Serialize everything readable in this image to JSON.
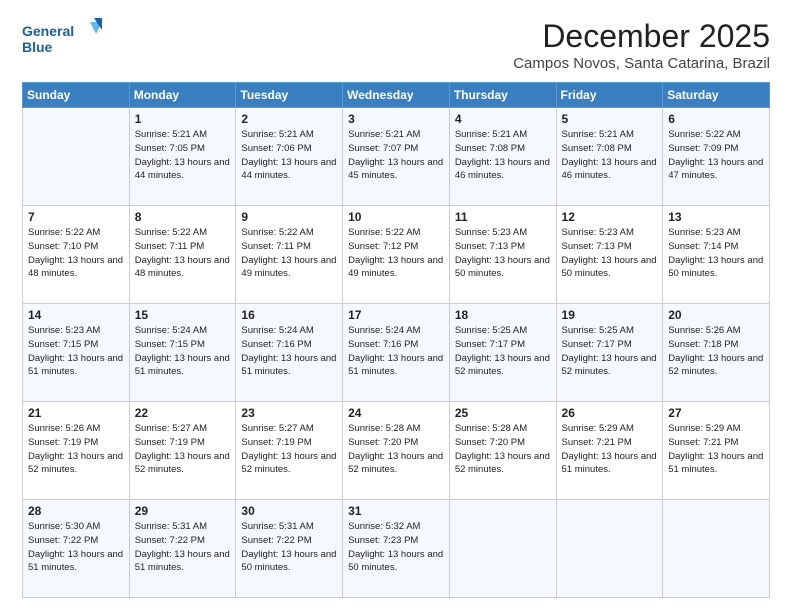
{
  "logo": {
    "line1": "General",
    "line2": "Blue"
  },
  "title": "December 2025",
  "location": "Campos Novos, Santa Catarina, Brazil",
  "weekdays": [
    "Sunday",
    "Monday",
    "Tuesday",
    "Wednesday",
    "Thursday",
    "Friday",
    "Saturday"
  ],
  "weeks": [
    [
      {
        "day": "",
        "sunrise": "",
        "sunset": "",
        "daylight": ""
      },
      {
        "day": "1",
        "sunrise": "Sunrise: 5:21 AM",
        "sunset": "Sunset: 7:05 PM",
        "daylight": "Daylight: 13 hours and 44 minutes."
      },
      {
        "day": "2",
        "sunrise": "Sunrise: 5:21 AM",
        "sunset": "Sunset: 7:06 PM",
        "daylight": "Daylight: 13 hours and 44 minutes."
      },
      {
        "day": "3",
        "sunrise": "Sunrise: 5:21 AM",
        "sunset": "Sunset: 7:07 PM",
        "daylight": "Daylight: 13 hours and 45 minutes."
      },
      {
        "day": "4",
        "sunrise": "Sunrise: 5:21 AM",
        "sunset": "Sunset: 7:08 PM",
        "daylight": "Daylight: 13 hours and 46 minutes."
      },
      {
        "day": "5",
        "sunrise": "Sunrise: 5:21 AM",
        "sunset": "Sunset: 7:08 PM",
        "daylight": "Daylight: 13 hours and 46 minutes."
      },
      {
        "day": "6",
        "sunrise": "Sunrise: 5:22 AM",
        "sunset": "Sunset: 7:09 PM",
        "daylight": "Daylight: 13 hours and 47 minutes."
      }
    ],
    [
      {
        "day": "7",
        "sunrise": "Sunrise: 5:22 AM",
        "sunset": "Sunset: 7:10 PM",
        "daylight": "Daylight: 13 hours and 48 minutes."
      },
      {
        "day": "8",
        "sunrise": "Sunrise: 5:22 AM",
        "sunset": "Sunset: 7:11 PM",
        "daylight": "Daylight: 13 hours and 48 minutes."
      },
      {
        "day": "9",
        "sunrise": "Sunrise: 5:22 AM",
        "sunset": "Sunset: 7:11 PM",
        "daylight": "Daylight: 13 hours and 49 minutes."
      },
      {
        "day": "10",
        "sunrise": "Sunrise: 5:22 AM",
        "sunset": "Sunset: 7:12 PM",
        "daylight": "Daylight: 13 hours and 49 minutes."
      },
      {
        "day": "11",
        "sunrise": "Sunrise: 5:23 AM",
        "sunset": "Sunset: 7:13 PM",
        "daylight": "Daylight: 13 hours and 50 minutes."
      },
      {
        "day": "12",
        "sunrise": "Sunrise: 5:23 AM",
        "sunset": "Sunset: 7:13 PM",
        "daylight": "Daylight: 13 hours and 50 minutes."
      },
      {
        "day": "13",
        "sunrise": "Sunrise: 5:23 AM",
        "sunset": "Sunset: 7:14 PM",
        "daylight": "Daylight: 13 hours and 50 minutes."
      }
    ],
    [
      {
        "day": "14",
        "sunrise": "Sunrise: 5:23 AM",
        "sunset": "Sunset: 7:15 PM",
        "daylight": "Daylight: 13 hours and 51 minutes."
      },
      {
        "day": "15",
        "sunrise": "Sunrise: 5:24 AM",
        "sunset": "Sunset: 7:15 PM",
        "daylight": "Daylight: 13 hours and 51 minutes."
      },
      {
        "day": "16",
        "sunrise": "Sunrise: 5:24 AM",
        "sunset": "Sunset: 7:16 PM",
        "daylight": "Daylight: 13 hours and 51 minutes."
      },
      {
        "day": "17",
        "sunrise": "Sunrise: 5:24 AM",
        "sunset": "Sunset: 7:16 PM",
        "daylight": "Daylight: 13 hours and 51 minutes."
      },
      {
        "day": "18",
        "sunrise": "Sunrise: 5:25 AM",
        "sunset": "Sunset: 7:17 PM",
        "daylight": "Daylight: 13 hours and 52 minutes."
      },
      {
        "day": "19",
        "sunrise": "Sunrise: 5:25 AM",
        "sunset": "Sunset: 7:17 PM",
        "daylight": "Daylight: 13 hours and 52 minutes."
      },
      {
        "day": "20",
        "sunrise": "Sunrise: 5:26 AM",
        "sunset": "Sunset: 7:18 PM",
        "daylight": "Daylight: 13 hours and 52 minutes."
      }
    ],
    [
      {
        "day": "21",
        "sunrise": "Sunrise: 5:26 AM",
        "sunset": "Sunset: 7:19 PM",
        "daylight": "Daylight: 13 hours and 52 minutes."
      },
      {
        "day": "22",
        "sunrise": "Sunrise: 5:27 AM",
        "sunset": "Sunset: 7:19 PM",
        "daylight": "Daylight: 13 hours and 52 minutes."
      },
      {
        "day": "23",
        "sunrise": "Sunrise: 5:27 AM",
        "sunset": "Sunset: 7:19 PM",
        "daylight": "Daylight: 13 hours and 52 minutes."
      },
      {
        "day": "24",
        "sunrise": "Sunrise: 5:28 AM",
        "sunset": "Sunset: 7:20 PM",
        "daylight": "Daylight: 13 hours and 52 minutes."
      },
      {
        "day": "25",
        "sunrise": "Sunrise: 5:28 AM",
        "sunset": "Sunset: 7:20 PM",
        "daylight": "Daylight: 13 hours and 52 minutes."
      },
      {
        "day": "26",
        "sunrise": "Sunrise: 5:29 AM",
        "sunset": "Sunset: 7:21 PM",
        "daylight": "Daylight: 13 hours and 51 minutes."
      },
      {
        "day": "27",
        "sunrise": "Sunrise: 5:29 AM",
        "sunset": "Sunset: 7:21 PM",
        "daylight": "Daylight: 13 hours and 51 minutes."
      }
    ],
    [
      {
        "day": "28",
        "sunrise": "Sunrise: 5:30 AM",
        "sunset": "Sunset: 7:22 PM",
        "daylight": "Daylight: 13 hours and 51 minutes."
      },
      {
        "day": "29",
        "sunrise": "Sunrise: 5:31 AM",
        "sunset": "Sunset: 7:22 PM",
        "daylight": "Daylight: 13 hours and 51 minutes."
      },
      {
        "day": "30",
        "sunrise": "Sunrise: 5:31 AM",
        "sunset": "Sunset: 7:22 PM",
        "daylight": "Daylight: 13 hours and 50 minutes."
      },
      {
        "day": "31",
        "sunrise": "Sunrise: 5:32 AM",
        "sunset": "Sunset: 7:23 PM",
        "daylight": "Daylight: 13 hours and 50 minutes."
      },
      {
        "day": "",
        "sunrise": "",
        "sunset": "",
        "daylight": ""
      },
      {
        "day": "",
        "sunrise": "",
        "sunset": "",
        "daylight": ""
      },
      {
        "day": "",
        "sunrise": "",
        "sunset": "",
        "daylight": ""
      }
    ]
  ]
}
